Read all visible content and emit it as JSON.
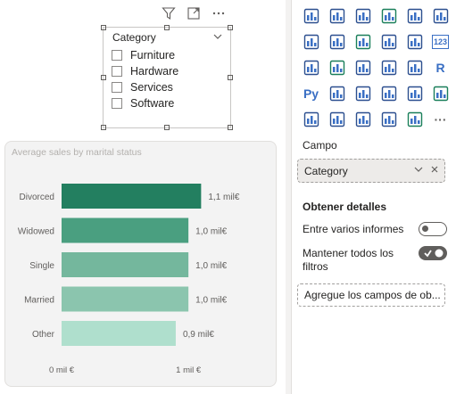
{
  "slicer": {
    "title": "Category",
    "items": [
      "Furniture",
      "Hardware",
      "Services",
      "Software"
    ]
  },
  "chart_data": {
    "type": "bar",
    "orientation": "horizontal",
    "title": "Average sales by marital status",
    "categories": [
      "Divorced",
      "Widowed",
      "Single",
      "Married",
      "Other"
    ],
    "values": [
      1.1,
      1.0,
      1.0,
      1.0,
      0.9
    ],
    "data_labels": [
      "1,1 mil€",
      "1,0 mil€",
      "1,0 mil€",
      "1,0 mil€",
      "0,9 mil€"
    ],
    "x_ticks": [
      "0 mil €",
      "1 mil €"
    ],
    "xlim": [
      0,
      1.02
    ],
    "colors": [
      "#237f60",
      "#4a9f80",
      "#74b79d",
      "#8bc5ae",
      "#afdfcd"
    ],
    "grid": false
  },
  "pane": {
    "viz_icons": [
      "stacked-column-chart-icon",
      "funnel-chart-icon",
      "scatter-chart-icon",
      "pie-chart-icon",
      "donut-chart-icon",
      "treemap-icon",
      "globe-map-icon",
      "filled-map-icon",
      "shape-map-icon",
      "azure-map-icon",
      "gauge-icon",
      "card-icon",
      "multi-row-card-icon",
      "kpi-icon",
      "slicer-icon",
      "table-icon",
      "matrix-icon",
      "r-visual-icon",
      "python-visual-icon",
      "key-influencers-icon",
      "decomposition-tree-icon",
      "qa-icon",
      "smart-narrative-icon",
      "goals-icon",
      "paginated-report-icon",
      "power-apps-icon",
      "power-automate-icon",
      "arrow-chevrons-icon",
      "dotted-grid-icon",
      "more-icon"
    ],
    "viz_icon_texts": {
      "card-icon": "123",
      "r-visual-icon": "R",
      "python-visual-icon": "Py",
      "more-icon": "···"
    },
    "field_label": "Campo",
    "field_value": "Category",
    "drillthrough_label": "Obtener detalles",
    "cross_report_label": "Entre varios informes",
    "keep_filters_label_line1": "Mantener todos los",
    "keep_filters_label_line2": "filtros",
    "add_fields_placeholder": "Agregue los campos de ob..."
  }
}
